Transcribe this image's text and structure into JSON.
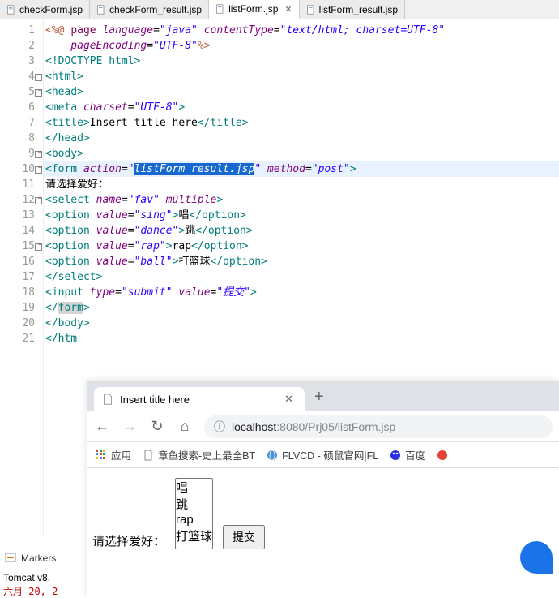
{
  "tabs": [
    {
      "label": "checkForm.jsp",
      "active": false
    },
    {
      "label": "checkForm_result.jsp",
      "active": false
    },
    {
      "label": "listForm.jsp",
      "active": true
    },
    {
      "label": "listForm_result.jsp",
      "active": false
    }
  ],
  "lines": {
    "n": [
      "1",
      "2",
      "3",
      "4",
      "5",
      "6",
      "7",
      "8",
      "9",
      "10",
      "11",
      "12",
      "13",
      "14",
      "15",
      "16",
      "17",
      "18",
      "19",
      "20",
      "21"
    ]
  },
  "code": {
    "l1a": "<%@ ",
    "l1b": "page ",
    "l1c": "language",
    "l1d": "=",
    "l1e": "\"java\"",
    "l1f": " contentType",
    "l1g": "=",
    "l1h": "\"text/html; charset=UTF-8\"",
    "l2a": "    pageEncoding",
    "l2b": "=",
    "l2c": "\"UTF-8\"",
    "l2d": "%>",
    "l3a": "<!DOCTYPE ",
    "l3b": "html",
    "l3c": ">",
    "l4": "<html>",
    "l5": "<head>",
    "l6a": "<",
    "l6b": "meta ",
    "l6c": "charset",
    "l6d": "=",
    "l6e": "\"UTF-8\"",
    "l6f": ">",
    "l7a": "<",
    "l7b": "title",
    "l7c": ">",
    "l7d": "Insert title here",
    "l7e": "</",
    "l7f": "title",
    "l7g": ">",
    "l8": "</head>",
    "l9": "<body>",
    "l10a": "<",
    "l10b": "form ",
    "l10c": "action",
    "l10d": "=",
    "l10e": "\"",
    "l10sel": "listForm_result.jsp",
    "l10f": "\"",
    "l10g": " method",
    "l10h": "=",
    "l10i": "\"post\"",
    "l10j": ">",
    "l11": "请选择爱好：",
    "l12a": "<",
    "l12b": "select ",
    "l12c": "name",
    "l12d": "=",
    "l12e": "\"fav\"",
    "l12f": " multiple",
    "l12g": ">",
    "l13a": "<",
    "l13b": "option ",
    "l13c": "value",
    "l13d": "=",
    "l13e": "\"sing\"",
    "l13f": ">",
    "l13g": "唱",
    "l13h": "</",
    "l13i": "option",
    "l13j": ">",
    "l14a": "<",
    "l14b": "option ",
    "l14c": "value",
    "l14d": "=",
    "l14e": "\"dance\"",
    "l14f": ">",
    "l14g": "跳",
    "l14h": "</",
    "l14i": "option",
    "l14j": ">",
    "l15a": "<",
    "l15b": "option ",
    "l15c": "value",
    "l15d": "=",
    "l15e": "\"rap\"",
    "l15f": ">",
    "l15g": "rap",
    "l15h": "</",
    "l15i": "option",
    "l15j": ">",
    "l16a": "<",
    "l16b": "option ",
    "l16c": "value",
    "l16d": "=",
    "l16e": "\"ball\"",
    "l16f": ">",
    "l16g": "打篮球",
    "l16h": "</",
    "l16i": "option",
    "l16j": ">",
    "l17": "</select>",
    "l18a": "<",
    "l18b": "input ",
    "l18c": "type",
    "l18d": "=",
    "l18e": "\"submit\"",
    "l18f": " value",
    "l18g": "=",
    "l18h": "\"提交\"",
    "l18i": ">",
    "l19a": "</",
    "l19b": "form",
    "l19c": ">",
    "l20": "</body>",
    "l21": "</htm"
  },
  "bottom": {
    "markers": "Markers",
    "server": "Tomcat v8.",
    "console": "六月 20, 2"
  },
  "browser": {
    "tab_title": "Insert title here",
    "url_host": "localhost",
    "url_rest": ":8080/Prj05/listForm.jsp",
    "bookmarks": {
      "apps": "应用",
      "b1": "章鱼搜索-史上最全BT",
      "b2": "FLVCD - 硕鼠官网|FL",
      "b3": "百度"
    },
    "page": {
      "label": "请选择爱好：",
      "options": [
        "唱",
        "跳",
        "rap",
        "打篮球"
      ],
      "submit": "提交"
    }
  }
}
